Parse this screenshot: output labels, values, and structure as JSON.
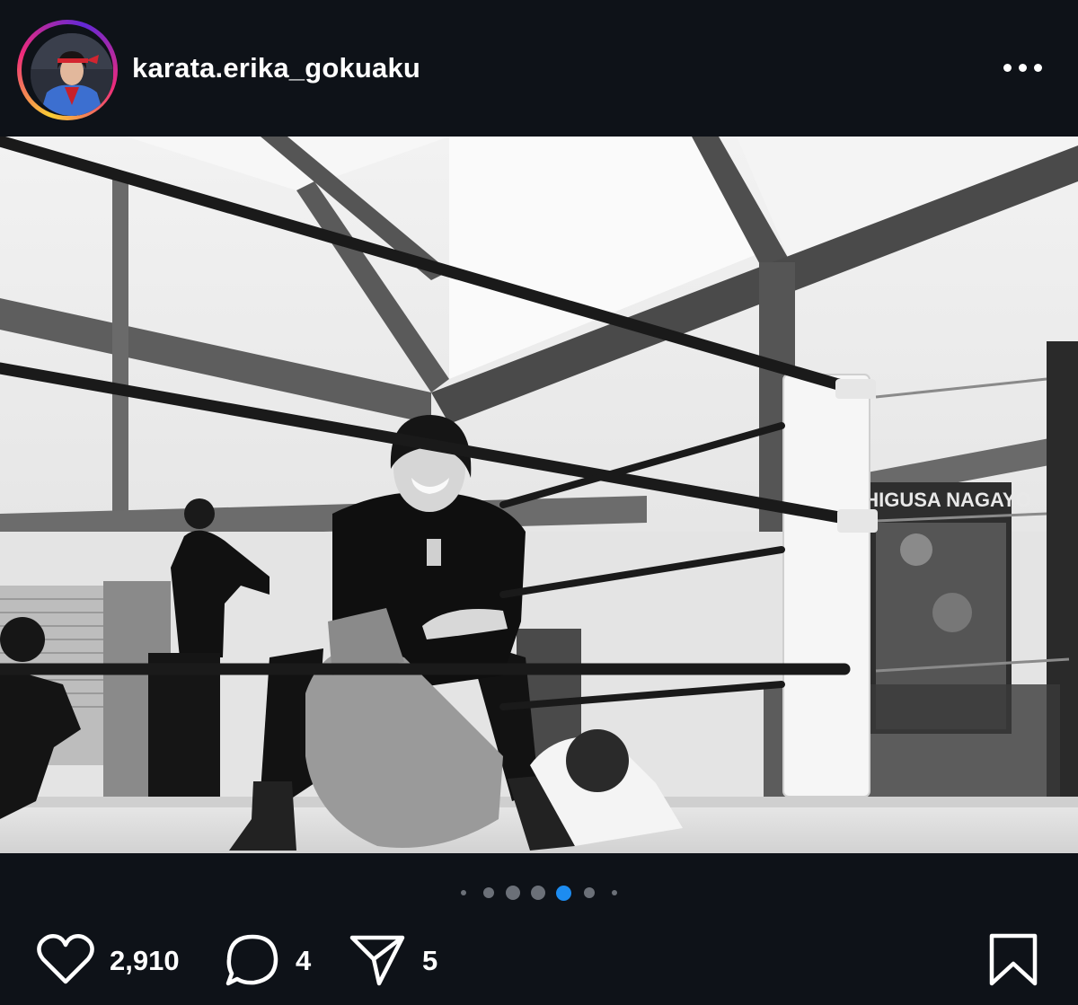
{
  "post": {
    "username": "karata.erika_gokuaku",
    "more_icon": "more-horizontal-icon",
    "photo_poster_text": "CHIGUSA NAGAYO",
    "carousel": {
      "total": 7,
      "active_index": 4
    },
    "actions": {
      "likes": "2,910",
      "comments": "4",
      "shares": "5",
      "like_icon": "heart-icon",
      "comment_icon": "comment-bubble-icon",
      "share_icon": "paper-plane-icon",
      "save_icon": "bookmark-icon"
    },
    "colors": {
      "background": "#0e1218",
      "active_dot": "#1d8cf0",
      "inactive_dot": "#6b7078",
      "text": "#ffffff"
    }
  }
}
